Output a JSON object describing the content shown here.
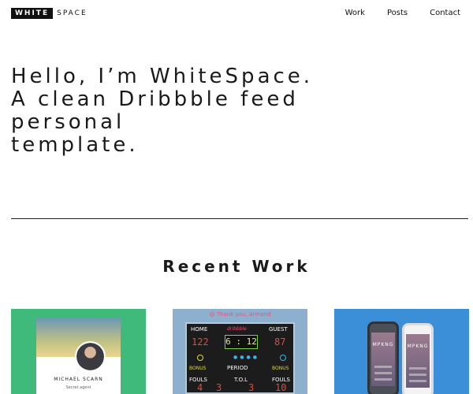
{
  "header": {
    "logo_box": "WHITE",
    "logo_text": "SPACE",
    "nav": [
      "Work",
      "Posts",
      "Contact"
    ]
  },
  "hero": {
    "lines": [
      "Hello, I’m WhiteSpace.",
      "A clean Dribbble feed",
      "personal",
      "template."
    ]
  },
  "recent": {
    "title": "Recent Work"
  },
  "cards": {
    "profile": {
      "name": "MICHAEL SCARN",
      "role": "Secret agent"
    },
    "scoreboard": {
      "thanks": "@ Thank you, Armand",
      "brand": "dribbble",
      "home_label": "HOME",
      "guest_label": "GUEST",
      "home_score": "122",
      "guest_score": "87",
      "clock": "6 : 12",
      "bonus_label": "BONUS",
      "period_label": "PERIOD",
      "fouls_label": "FOULS",
      "tol_label": "T.O.L",
      "home_fouls": "4",
      "period": "3",
      "tol": "3",
      "guest_fouls": "10"
    },
    "app": {
      "title": "MPKNG"
    }
  },
  "colors": {
    "card1_bg": "#3fba7a",
    "card2_bg": "#8db0cf",
    "card3_bg": "#3a8fd8"
  }
}
